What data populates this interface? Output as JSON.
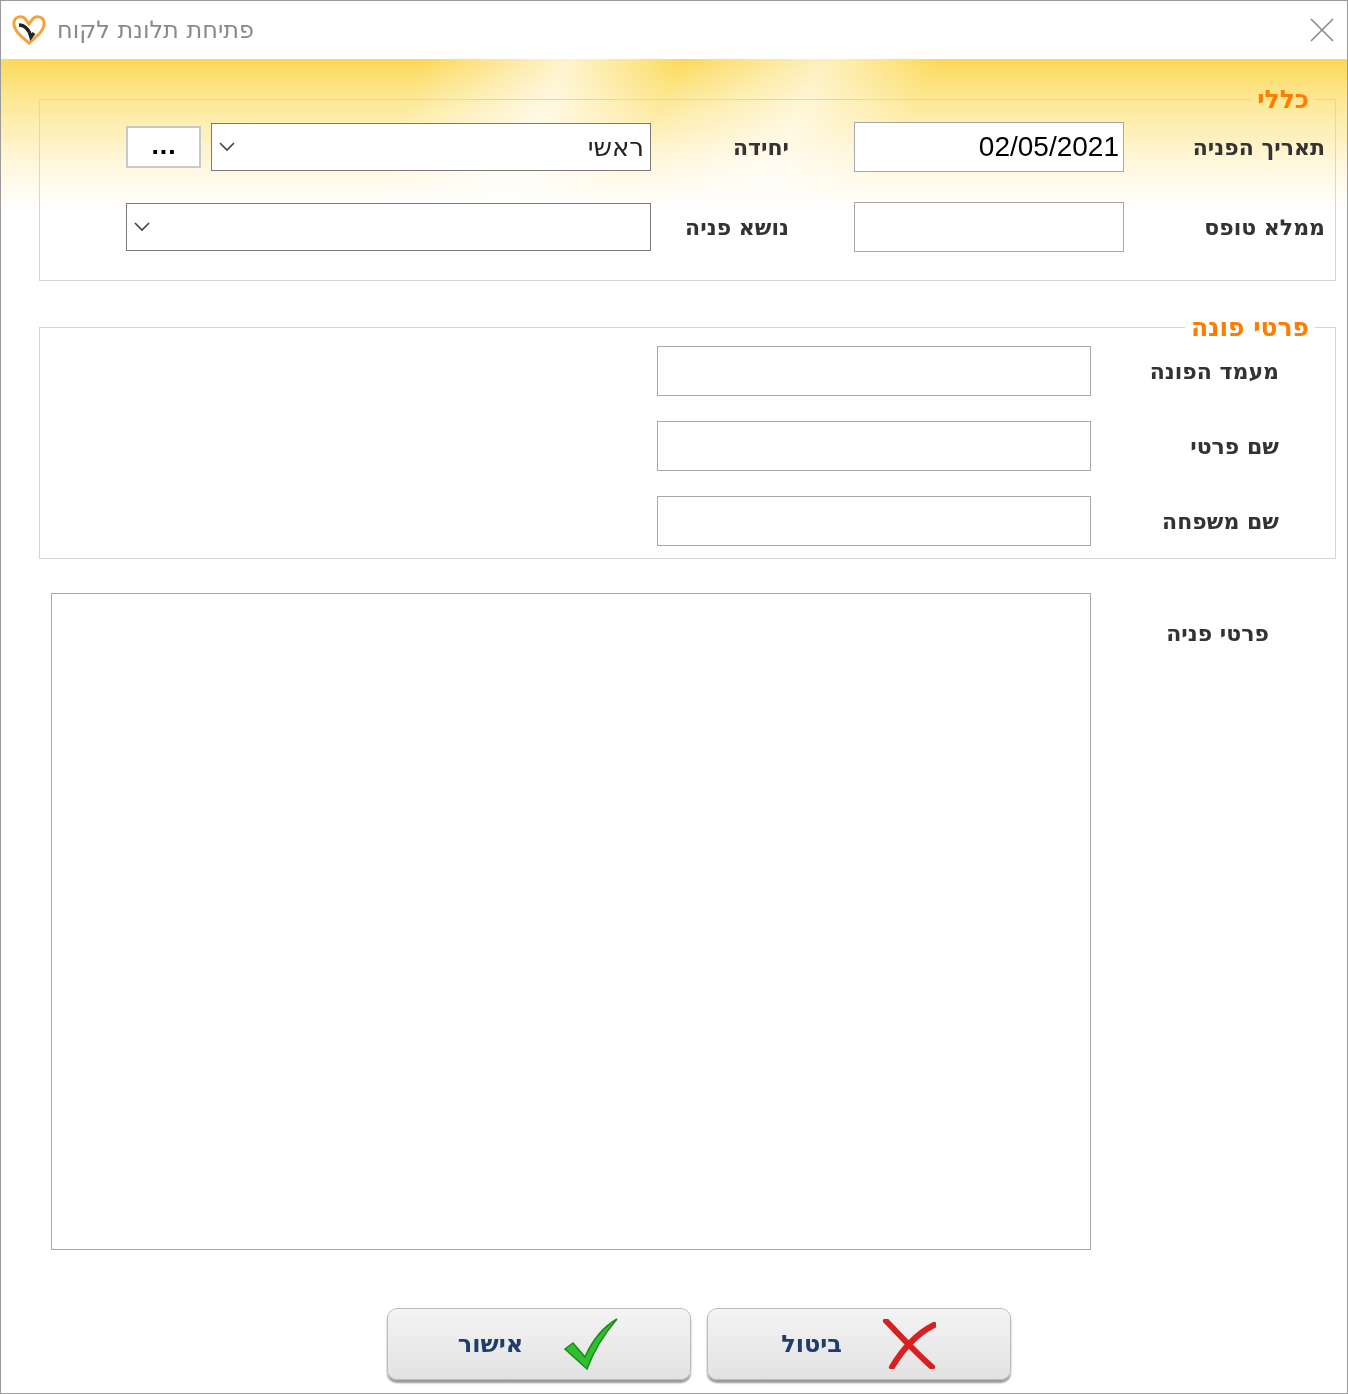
{
  "window": {
    "title": "פתיחת תלונת לקוח"
  },
  "general": {
    "legend": "כללי",
    "rows": [
      [
        {
          "label": "תאריך הפניה",
          "kind": "text",
          "value": "02/05/2021"
        },
        {
          "label": "יחידה",
          "kind": "combo",
          "value": "ראשי",
          "browse": "..."
        }
      ],
      [
        {
          "label": "ממלא טופס",
          "kind": "text"
        },
        {
          "label": "נושא פניה",
          "kind": "combo"
        }
      ]
    ]
  },
  "contact": {
    "legend": "פרטי פונה",
    "fields": [
      {
        "label": "מעמד הפונה"
      },
      {
        "label": "שם פרטי"
      },
      {
        "label": "שם משפחה"
      }
    ]
  },
  "details": {
    "label": "פרטי פניה"
  },
  "buttons": [
    {
      "kind": "cancel",
      "label": "ביטול"
    },
    {
      "kind": "ok",
      "label": "אישור"
    }
  ]
}
